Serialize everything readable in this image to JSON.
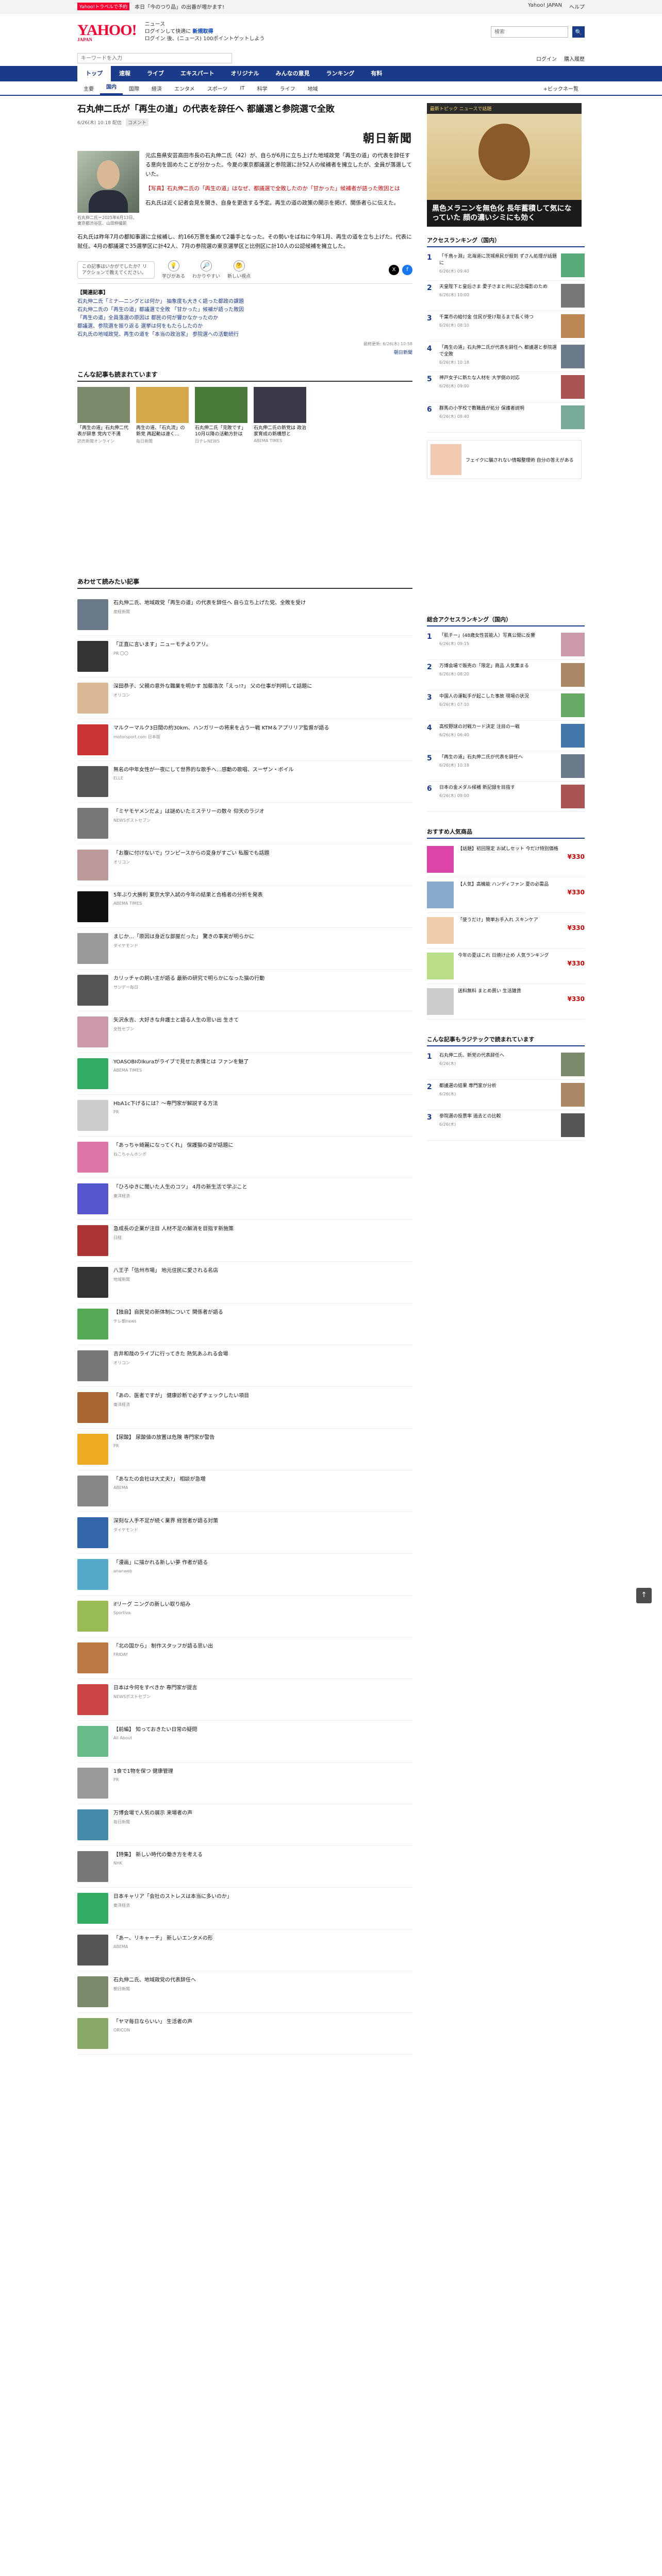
{
  "topbar": {
    "promo": "Yahoo!トラベルで予約",
    "text": "本日「今のつり品」の出番が増かます!",
    "links": [
      "Yahoo! JAPAN",
      "ヘルプ"
    ]
  },
  "header": {
    "logo": "YAHOO!",
    "logo_sub": "JAPAN",
    "service": "ニュース",
    "line1": "ログインして快適に ",
    "line1_link": "新規取得",
    "line2": "ログイン 後、(ニュース) 100ポイントゲットしよう",
    "search_placeholder": "検索",
    "search_button": "🔍"
  },
  "subsearch": {
    "placeholder": "キーワードを入力",
    "links": [
      "ログイン",
      "購入履歴"
    ]
  },
  "main_nav": [
    "トップ",
    "速報",
    "ライブ",
    "エキスパート",
    "オリジナル",
    "みんなの意見",
    "ランキング",
    "有料"
  ],
  "cat_nav": [
    "主要",
    "国内",
    "国際",
    "経済",
    "エンタメ",
    "スポーツ",
    "IT",
    "科学",
    "ライフ",
    "地域"
  ],
  "cat_more": "+ビックネー覧",
  "article": {
    "title": "石丸伸二氏が「再生の道」の代表を辞任へ 都議選と参院選で全敗",
    "date": "6/26(木) 10:18 配信",
    "comments": "コメント",
    "source": "朝日新聞",
    "caption": "石丸伸二氏＝2025年6月13日、東京都渋谷区、山田伸撮影",
    "lead": [
      "元広島県安芸高田市長の石丸伸二氏（42）が、自らが6月に立ち上げた地域政党「再生の道」の代表を辞任する意向を固めたことが分かった。今夏の東京都議選と参院選に計52人の候補者を擁立したが、全員が落選していた。",
      "【写真】石丸伸二氏の「再生の道」はなぜ、都議選で全敗したのか「甘かった」候補者が語った敗因とは",
      "石丸氏は近く記者会見を開き、自身を更迭する予定。再生の道の政策の開示を掲げ、関係者らに伝えた。"
    ],
    "body": "石丸氏は昨年7月の都知事選に立候補し、約166万票を集めて2番手となった。その勢いをばねに今年1月、再生の道を立ち上げた。代表に就任。4月の都議選で35選挙区に計42人、7月の参院選の東京選挙区と比例区に計10人の公認候補を擁立した。",
    "bubble": "この記事はいかがでしたか？リアクションで教えてください。",
    "reactions": [
      {
        "icon": "💡",
        "label": "学びがある"
      },
      {
        "icon": "🔎",
        "label": "わかりやすい"
      },
      {
        "icon": "🤔",
        "label": "新しい視点"
      }
    ],
    "related_title": "【関連記事】",
    "related": [
      "石丸伸二氏「ミナ―ニングとは何か」 抽象度も大きく語った都政の課題",
      "石丸伸二氏の「再生の道」都議選で全敗 「甘かった」候補が語った敗因",
      "「再生の道」全員落選の原因は 都民の何が響かなかったのか",
      "都議選、参院選を振り返る 選挙は何をもたらしたのか",
      "石丸氏の地域政党、再生の道を「本当の政治家」 参院選への活動続行"
    ],
    "copyright": "最終更新: 6/26(木) 10:58",
    "more": "朝日新聞"
  },
  "read_section": {
    "title": "こんな記事も読まれています",
    "cards": [
      {
        "title": "「再生の道」石丸伸二代表が辞意 党内で不満",
        "meta": "読売新聞オンライン",
        "color": "#7a8a6a"
      },
      {
        "title": "再生の道、「石丸流」の新党 再起動は遠く…",
        "meta": "毎日新聞",
        "color": "#d4a84a"
      },
      {
        "title": "石丸伸二氏「完敗です」 10月以降の活動方針は",
        "meta": "日テレNEWS",
        "color": "#4a7a3a"
      },
      {
        "title": "石丸伸二氏の新党は 政治家育成の新構想と",
        "meta": "ABEMA TIMES",
        "color": "#3a3a4a"
      }
    ]
  },
  "feed_section": {
    "title": "あわせて読みたい記事",
    "items": [
      {
        "title": "石丸伸二氏、地域政党「再生の道」の代表を辞任へ 自ら立ち上げた党、全敗を受け",
        "meta": "産経新聞",
        "color": "#6a7a8a"
      },
      {
        "title": "「正直に言います」ニューモチよりアリ。",
        "meta": "PR 〇〇",
        "color": "#333"
      },
      {
        "title": "深田恭子、父親の意外な職業を明かす 加藤浩次「えっ!?」 父の仕事が判明して話題に",
        "meta": "オリコン",
        "color": "#d9b896"
      },
      {
        "title": "マルクーマルク3日間の約30km、ハンガリーの将来を占う一戦 KTM＆アプリリア監督が語る",
        "meta": "motorsport.com 日本版",
        "color": "#c33"
      },
      {
        "title": "無名の中年女性が一夜にして世界的な歌手へ…感動の歌唱、スーザン・ボイル",
        "meta": "ELLE",
        "color": "#555"
      },
      {
        "title": "「ミヤモヤメンだよ」は謎めいたミステリーの数々 仰天のラジオ",
        "meta": "NEWSポストセブン",
        "color": "#777"
      },
      {
        "title": "「お腹に付けないで」ワンピースからの変身がすごい 私服でも話題",
        "meta": "オリコン",
        "color": "#b99"
      },
      {
        "title": "5年ぶり大勝利 東京大学入試の今年の結果と合格者の分析を発表",
        "meta": "ABEMA TIMES",
        "color": "#111"
      },
      {
        "title": "まじか…「原因は身近な部屋だった」 驚きの事実が明らかに",
        "meta": "ダイヤモンド",
        "color": "#999"
      },
      {
        "title": "カリッチャの飼い主が語る 最新の研究で明らかになった猫の行動",
        "meta": "サンデー毎日",
        "color": "#555"
      },
      {
        "title": "矢沢永吉、大好きな弁護士と語る人生の思い出 生きて",
        "meta": "女性セブン",
        "color": "#c9a"
      },
      {
        "title": "YOASOBIのIkuraがライブで見せた表情とは ファンを魅了",
        "meta": "ABEMA TIMES",
        "color": "#3a6"
      },
      {
        "title": "HbA1c下げるには？～専門家が解説する方法",
        "meta": "PR",
        "color": "#ccc"
      },
      {
        "title": "「あっちゃ綺麗になってくれ」 保護猫の姿が話題に",
        "meta": "ねこちゃんホンポ",
        "color": "#d7a"
      },
      {
        "title": "「ひろゆきに聞いた人生のコツ」 4月の新生活で学ぶこと",
        "meta": "東洋経済",
        "color": "#55c"
      },
      {
        "title": "急成長の企業が注目 人材不足の解消を目指す新施策",
        "meta": "日経",
        "color": "#a33"
      },
      {
        "title": "八王子「信州市場」 地元住民に愛される名店",
        "meta": "地域新聞",
        "color": "#333"
      },
      {
        "title": "【独自】自民党の新体制について 関係者が語る",
        "meta": "テレ朝news",
        "color": "#5a5"
      },
      {
        "title": "吉井和哉のライブに行ってきた 熱気あふれる会場",
        "meta": "オリコン",
        "color": "#777"
      },
      {
        "title": "「あの、医者ですが」 健康診断で必ずチェックしたい項目",
        "meta": "東洋経済",
        "color": "#a63"
      },
      {
        "title": "【尿酸】 尿酸値の放置は危険 専門家が警告",
        "meta": "PR",
        "color": "#ea2"
      },
      {
        "title": "「あなたの会社は大丈夫?」 相談が急増",
        "meta": "ABEMA",
        "color": "#888"
      },
      {
        "title": "深刻な人手不足が続く業界 経営者が語る対策",
        "meta": "ダイヤモンド",
        "color": "#36a"
      },
      {
        "title": "「漫画」に描かれる新しい夢 作者が語る",
        "meta": "ananweb",
        "color": "#5ac"
      },
      {
        "title": "ifリーグ ニングの新しい取り組み",
        "meta": "Sportiva",
        "color": "#9b5"
      },
      {
        "title": "「北の国から」 制作スタッフが語る思い出",
        "meta": "FRIDAY",
        "color": "#b74"
      },
      {
        "title": "日本は今何をすべきか 専門家が提言",
        "meta": "NEWSポストセブン",
        "color": "#c44"
      },
      {
        "title": "【前編】 知っておきたい日常の疑問",
        "meta": "All About",
        "color": "#6b8"
      },
      {
        "title": "1食で1物を保つ 健康管理",
        "meta": "PR",
        "color": "#999"
      },
      {
        "title": "万博会場で人気の展示 来場者の声",
        "meta": "毎日新聞",
        "color": "#48a"
      },
      {
        "title": "【特集】 新しい時代の働き方を考える",
        "meta": "NHK",
        "color": "#777"
      },
      {
        "title": "日本キャリア「会社のストレスは本当に多いのか」",
        "meta": "東洋経済",
        "color": "#3a6"
      },
      {
        "title": "「あー、リキャーチ」 新しいエンタメの形",
        "meta": "ABEMA",
        "color": "#555"
      },
      {
        "title": "石丸伸二氏、地域政党の代表辞任へ",
        "meta": "朝日新聞",
        "color": "#7a8a6a"
      },
      {
        "title": "「ヤマ毎日ならいい」 生活者の声",
        "meta": "ORICON",
        "color": "#8a6"
      }
    ]
  },
  "sidebar": {
    "ad1": {
      "head": "最新トピック ニュースで話題",
      "foot": "黒色メラニンを無色化 長年蓄積して気になっていた 顔の濃いシミにも効く"
    },
    "rank1_title": "アクセスランキング（国内）",
    "rank1": [
      {
        "title": "「千鳥ヶ淵」北海道に茨城県民が殺到 ずさん処理が話題に",
        "meta": "6/26(木) 09:40",
        "color": "#5a7"
      },
      {
        "title": "天皇陛下と皇后さま 愛子さまと共に記念撮影のため",
        "meta": "6/26(木) 10:00",
        "color": "#777"
      },
      {
        "title": "千葉市の給付金 住民が受け取るまで長く待つ",
        "meta": "6/26(木) 08:10",
        "color": "#b85"
      },
      {
        "title": "「再生の道」石丸伸二氏が代表を辞任へ 都議選と参院選で全敗",
        "meta": "6/26(木) 10:18",
        "color": "#6a7a8a"
      },
      {
        "title": "神戸女子に新たな人材を 大学側の対応",
        "meta": "6/26(木) 09:00",
        "color": "#a55"
      },
      {
        "title": "群馬の小学校で教職員が処分 保護者説明",
        "meta": "6/26(木) 08:40",
        "color": "#7a9"
      }
    ],
    "ad2": "フェイクに騙されない情報整理術 自分の答えがある",
    "rank2_title": "総合アクセスランキング（国内）",
    "rank2": [
      {
        "title": "「肌チー」(48歳女性芸能人）写真公開に反響",
        "meta": "6/26(木) 09:15",
        "color": "#c9a"
      },
      {
        "title": "万博会場で販売の「限定」商品 人気集まる",
        "meta": "6/26(木) 08:20",
        "color": "#a86"
      },
      {
        "title": "中国人の運転手が起こした事故 現場の状況",
        "meta": "6/26(木) 07:10",
        "color": "#6a6"
      },
      {
        "title": "高校野球の対戦カード決定 注目の一戦",
        "meta": "6/26(木) 06:40",
        "color": "#47a"
      },
      {
        "title": "「再生の道」石丸伸二氏が代表を辞任へ",
        "meta": "6/26(木) 10:18",
        "color": "#6a7a8a"
      },
      {
        "title": "日本の金メダル候補 新記録を目指す",
        "meta": "6/26(木) 09:00",
        "color": "#a55"
      }
    ],
    "prod_title": "おすすめ人気商品",
    "products": [
      {
        "title": "【話題】初回限定 お試しセット 今だけ特別価格",
        "price": "¥330",
        "color": "#d4a"
      },
      {
        "title": "【人気】高機能 ハンディファン 夏の必需品",
        "price": "¥330",
        "color": "#8ac"
      },
      {
        "title": "「使うだけ」簡単お手入れ スキンケア",
        "price": "¥330",
        "color": "#eca"
      },
      {
        "title": "今年の夏はこれ 日焼け止め 人気ランキング",
        "price": "¥330",
        "color": "#bd8"
      },
      {
        "title": "送料無料 まとめ買い 生活雑貨",
        "price": "¥330",
        "color": "#ccc"
      }
    ],
    "ad3_title": "こんな記事もラジテックで読まれています",
    "ad3": [
      {
        "title": "石丸伸二氏、新党の代表辞任へ",
        "meta": "6/26(木)",
        "color": "#7a8a6a"
      },
      {
        "title": "都議選の結果 専門家が分析",
        "meta": "6/26(木)",
        "color": "#a86"
      },
      {
        "title": "参院選の投票率 過去との比較",
        "meta": "6/26(木)",
        "color": "#555"
      }
    ]
  },
  "scroll_top": "↑",
  "colors": {
    "brand": "#ff0033",
    "nav": "#1a3a8a"
  }
}
